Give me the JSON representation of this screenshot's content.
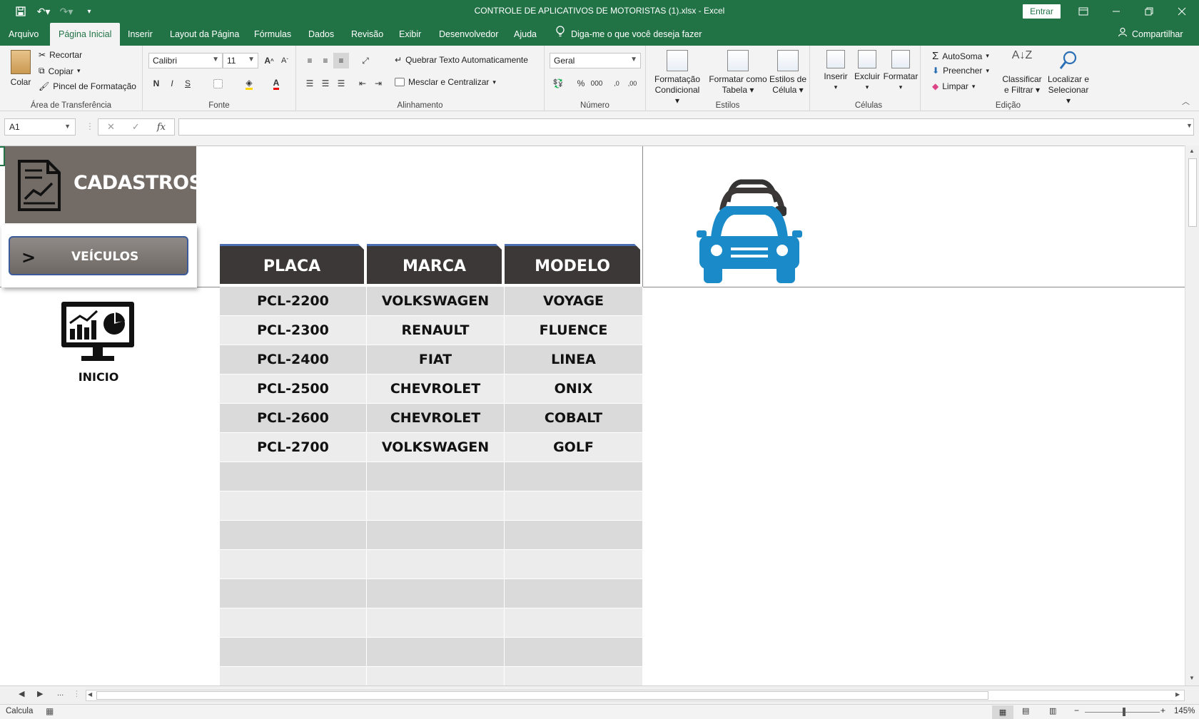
{
  "titlebar": {
    "title": "CONTROLE DE APLICATIVOS DE MOTORISTAS (1).xlsx  -  Excel",
    "signin_label": "Entrar"
  },
  "tabs": [
    {
      "label": "Arquivo"
    },
    {
      "label": "Página Inicial"
    },
    {
      "label": "Inserir"
    },
    {
      "label": "Layout da Página"
    },
    {
      "label": "Fórmulas"
    },
    {
      "label": "Dados"
    },
    {
      "label": "Revisão"
    },
    {
      "label": "Exibir"
    },
    {
      "label": "Desenvolvedor"
    },
    {
      "label": "Ajuda"
    }
  ],
  "tellme": "Diga-me o que você deseja fazer",
  "share": "Compartilhar",
  "ribbon": {
    "clipboard": {
      "paste": "Colar",
      "cut": "Recortar",
      "copy": "Copiar",
      "painter": "Pincel de Formatação",
      "label": "Área de Transferência"
    },
    "font": {
      "name": "Calibri",
      "size": "11",
      "bold": "N",
      "italic": "I",
      "underline": "S",
      "grow": "A",
      "shrink": "A",
      "color": "A",
      "label": "Fonte"
    },
    "alignment": {
      "wrap": "Quebrar Texto Automaticamente",
      "merge": "Mesclar e Centralizar",
      "label": "Alinhamento"
    },
    "number": {
      "format": "Geral",
      "percent": "%",
      "thousands": "000",
      "label": "Número"
    },
    "styles": {
      "cond1": "Formatação",
      "cond2": "Condicional",
      "table1": "Formatar como",
      "table2": "Tabela",
      "cell1": "Estilos de",
      "cell2": "Célula",
      "label": "Estilos"
    },
    "cells": {
      "insert": "Inserir",
      "delete": "Excluir",
      "format": "Formatar",
      "label": "Células"
    },
    "editing": {
      "autosum": "AutoSoma",
      "fill": "Preencher",
      "clear": "Limpar",
      "sort1": "Classificar",
      "sort2": "e Filtrar",
      "find1": "Localizar e",
      "find2": "Selecionar",
      "label": "Edição"
    }
  },
  "formula_bar": {
    "name_box": "A1",
    "cancel": "✕",
    "enter": "✓",
    "fx": "fx",
    "value": ""
  },
  "sheet": {
    "cadastros": "CADASTROS",
    "veiculos_arrow": ">",
    "veiculos": "VEÍCULOS",
    "inicio": "INICIO",
    "headers": [
      "PLACA",
      "MARCA",
      "MODELO"
    ],
    "rows": [
      [
        "PCL-2200",
        "VOLKSWAGEN",
        "VOYAGE"
      ],
      [
        "PCL-2300",
        "RENAULT",
        "FLUENCE"
      ],
      [
        "PCL-2400",
        "FIAT",
        "LINEA"
      ],
      [
        "PCL-2500",
        "CHEVROLET",
        "ONIX"
      ],
      [
        "PCL-2600",
        "CHEVROLET",
        "COBALT"
      ],
      [
        "PCL-2700",
        "VOLKSWAGEN",
        "GOLF"
      ],
      [
        "",
        "",
        ""
      ],
      [
        "",
        "",
        ""
      ],
      [
        "",
        "",
        ""
      ],
      [
        "",
        "",
        ""
      ],
      [
        "",
        "",
        ""
      ],
      [
        "",
        "",
        ""
      ],
      [
        "",
        "",
        ""
      ],
      [
        "",
        "",
        ""
      ]
    ]
  },
  "sheet_nav": {
    "ellipsis": "..."
  },
  "status": {
    "mode": "Calcula",
    "zoom": "145%"
  },
  "colors": {
    "excel_green": "#217346",
    "car_blue": "#1b8ac9",
    "header_dark": "#3c3838",
    "cadastros_bg": "#726b66"
  }
}
